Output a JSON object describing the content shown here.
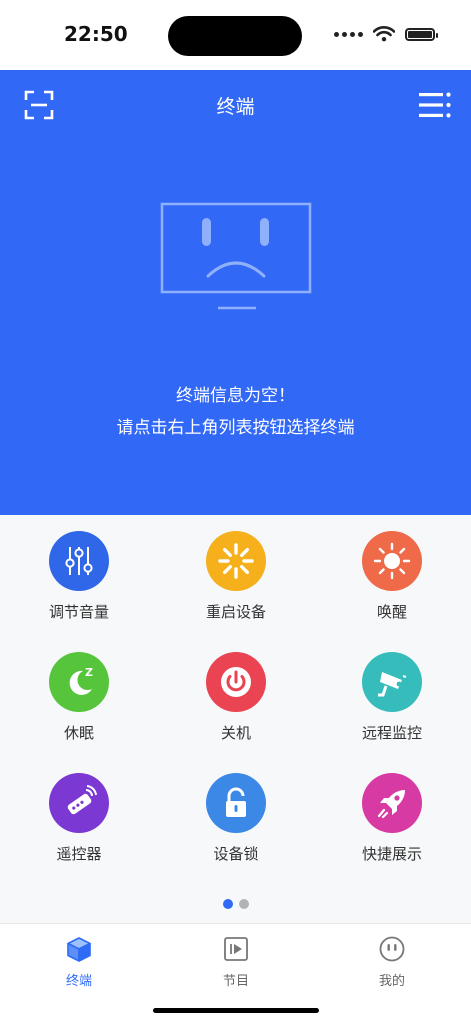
{
  "status": {
    "time": "22:50"
  },
  "header": {
    "title": "终端"
  },
  "empty_state": {
    "line1": "终端信息为空！",
    "line2": "请点击右上角列表按钮选择终端"
  },
  "grid": {
    "items": [
      {
        "label": "调节音量",
        "icon": "sliders-icon",
        "color": "#2f67e8"
      },
      {
        "label": "重启设备",
        "icon": "sunburst-icon",
        "color": "#f5b01c"
      },
      {
        "label": "唤醒",
        "icon": "sun-icon",
        "color": "#ee6a48"
      },
      {
        "label": "休眠",
        "icon": "moon-icon",
        "color": "#57c53b"
      },
      {
        "label": "关机",
        "icon": "power-icon",
        "color": "#ea4453"
      },
      {
        "label": "远程监控",
        "icon": "camera-icon",
        "color": "#37bcbc"
      },
      {
        "label": "遥控器",
        "icon": "remote-icon",
        "color": "#7b38d3"
      },
      {
        "label": "设备锁",
        "icon": "lock-icon",
        "color": "#3b88e6"
      },
      {
        "label": "快捷展示",
        "icon": "rocket-icon",
        "color": "#d83aa3"
      }
    ],
    "page_count": 2,
    "current_page": 1
  },
  "tabbar": {
    "tabs": [
      {
        "label": "终端",
        "icon": "cube-icon",
        "active": true
      },
      {
        "label": "节目",
        "icon": "play-icon",
        "active": false
      },
      {
        "label": "我的",
        "icon": "face-icon",
        "active": false
      }
    ]
  },
  "colors": {
    "accent": "#3268f6",
    "tab_active": "#2f6bf5"
  }
}
